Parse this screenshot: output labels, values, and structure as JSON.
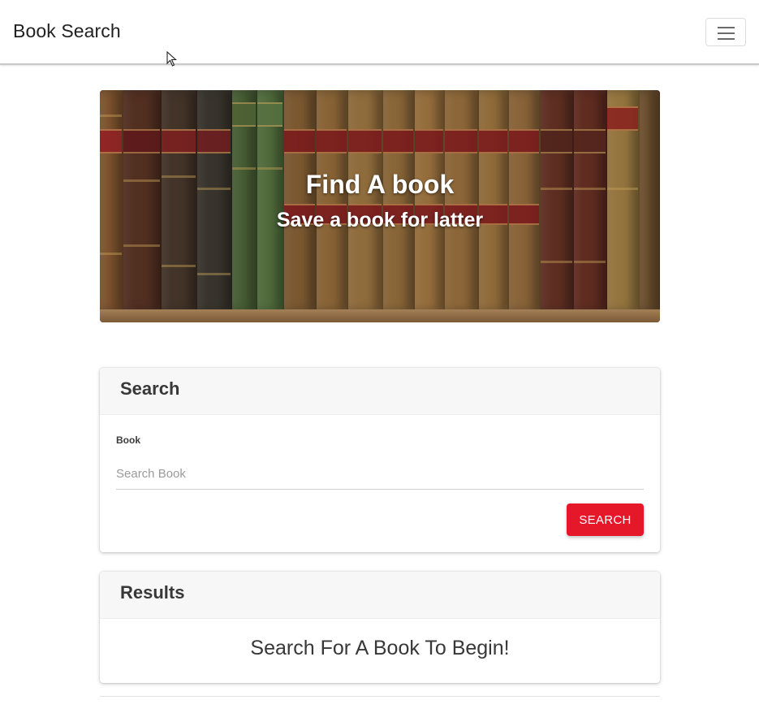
{
  "navbar": {
    "brand": "Book Search",
    "toggler_icon": "hamburger-menu-icon"
  },
  "hero": {
    "title": "Find A book",
    "subtitle": "Save a book for latter"
  },
  "search": {
    "header": "Search",
    "field_label": "Book",
    "placeholder": "Search Book",
    "value": "",
    "button_label": "SEARCH"
  },
  "results": {
    "header": "Results",
    "message": "Search For A Book To Begin!"
  },
  "colors": {
    "accent": "#e5182a",
    "card_header_bg": "#f7f7f7",
    "text": "#383838"
  }
}
